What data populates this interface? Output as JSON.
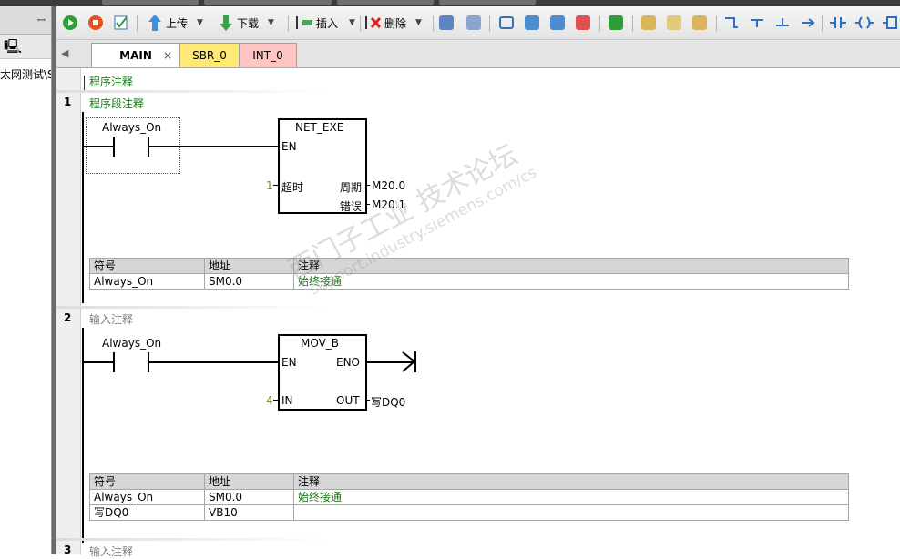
{
  "left_panel": {
    "pin_glyph": "ꟷ",
    "header_glyph": "🖳",
    "tree_text": "太网测试\\S"
  },
  "toolbar": {
    "upload_label": "上传",
    "download_label": "下载",
    "insert_label": "插入",
    "delete_label": "删除"
  },
  "tabs": [
    {
      "label": "MAIN",
      "close": "×"
    },
    {
      "label": "SBR_0"
    },
    {
      "label": "INT_0"
    }
  ],
  "program_comment": "程序注释",
  "networks": [
    {
      "number": "1",
      "comment": "程序段注释",
      "contact": "Always_On",
      "box": {
        "title": "NET_EXE",
        "en": "EN",
        "in_value": "1",
        "in_label": "超时",
        "out1_label": "周期",
        "out1_value": "M20.0",
        "out2_label": "错误",
        "out2_value": "M20.1"
      },
      "symbols": {
        "headers": [
          "符号",
          "地址",
          "注释"
        ],
        "rows": [
          [
            "Always_On",
            "SM0.0",
            "始终接通"
          ]
        ]
      }
    },
    {
      "number": "2",
      "comment": "输入注释",
      "contact": "Always_On",
      "box": {
        "title": "MOV_B",
        "en": "EN",
        "eno": "ENO",
        "in_value": "4",
        "in_label": "IN",
        "out_label": "OUT",
        "out_value": "写DQ0"
      },
      "symbols": {
        "headers": [
          "符号",
          "地址",
          "注释"
        ],
        "rows": [
          [
            "Always_On",
            "SM0.0",
            "始终接通"
          ],
          [
            "写DQ0",
            "VB10",
            ""
          ]
        ]
      }
    },
    {
      "number": "3",
      "comment": "输入注释"
    }
  ],
  "watermark": {
    "line1": "西门子工业 技术论坛",
    "line2": "support.industry.siemens.com/cs"
  },
  "colors": {
    "comment_green": "#1b7a1b",
    "tab_sbr": "#ffe873",
    "tab_int": "#ffc4c4"
  }
}
